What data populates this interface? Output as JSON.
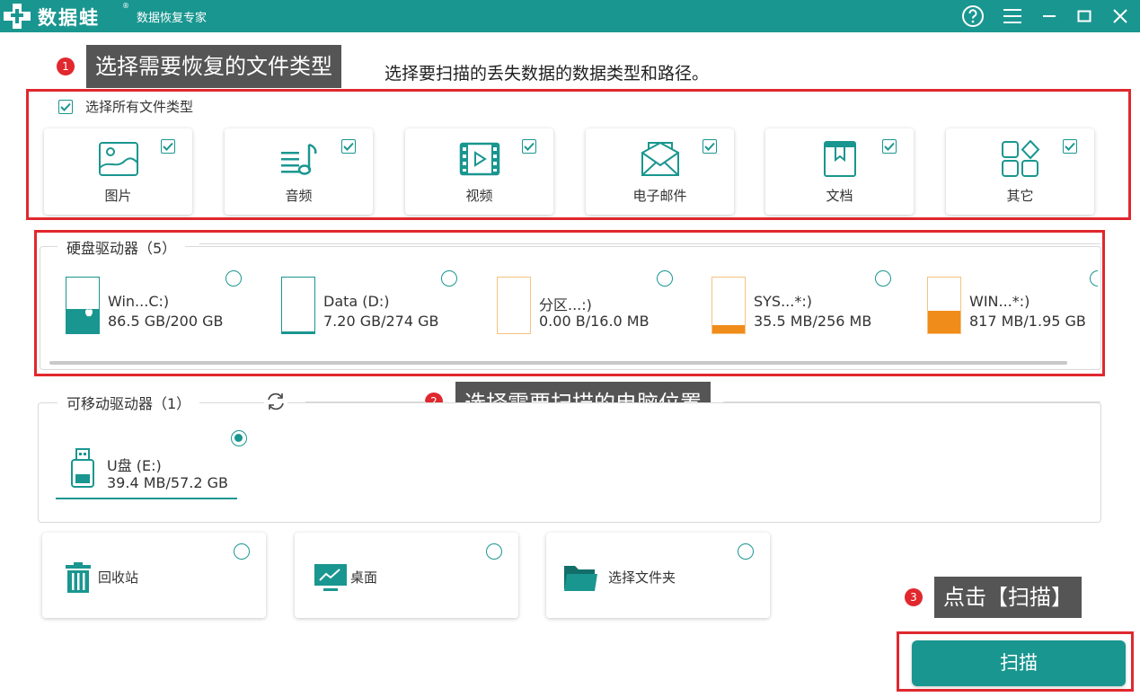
{
  "app": {
    "name": "数据蛙",
    "registered_mark": "®",
    "subtitle": "数据恢复专家"
  },
  "colors": {
    "brand": "#1a9690",
    "accent_red": "#e0282e",
    "orange": "#f08c1a",
    "callout_bg": "#555555"
  },
  "titlebar_icons": [
    "help-icon",
    "menu-icon",
    "minimize-icon",
    "maximize-icon",
    "close-icon"
  ],
  "callouts": [
    {
      "num": "1",
      "text": "选择需要恢复的文件类型"
    },
    {
      "num": "2",
      "text": "选择需要扫描的电脑位置"
    },
    {
      "num": "3",
      "text": "点击【扫描】"
    }
  ],
  "instruction": "选择要扫描的丢失数据的数据类型和路径。",
  "file_types": {
    "select_all_label": "选择所有文件类型",
    "select_all_checked": true,
    "items": [
      {
        "label": "图片",
        "icon": "image-icon",
        "checked": true
      },
      {
        "label": "音频",
        "icon": "music-icon",
        "checked": true
      },
      {
        "label": "视频",
        "icon": "video-icon",
        "checked": true
      },
      {
        "label": "电子邮件",
        "icon": "email-icon",
        "checked": true
      },
      {
        "label": "文档",
        "icon": "document-icon",
        "checked": true
      },
      {
        "label": "其它",
        "icon": "other-icon",
        "checked": true
      }
    ]
  },
  "hard_drives": {
    "title": "硬盘驱动器（5）",
    "items": [
      {
        "name": "Win...C:)",
        "size": "86.5 GB/200 GB",
        "usage": 0.43,
        "color": "#1a9690",
        "outline": "#1a9690",
        "system": true,
        "selected": false
      },
      {
        "name": "Data (D:)",
        "size": "7.20 GB/274 GB",
        "usage": 0.03,
        "color": "#1a9690",
        "outline": "#1a9690",
        "system": false,
        "selected": false
      },
      {
        "name": "分区...:)",
        "size": "0.00  B/16.0 MB",
        "usage": 0,
        "color": "#f08c1a",
        "outline": "#f5c280",
        "system": false,
        "selected": false
      },
      {
        "name": "SYS...*:)",
        "size": "35.5 MB/256 MB",
        "usage": 0.14,
        "color": "#f08c1a",
        "outline": "#f5c280",
        "system": false,
        "selected": false
      },
      {
        "name": "WIN...*:)",
        "size": "817 MB/1.95 GB",
        "usage": 0.41,
        "color": "#f08c1a",
        "outline": "#f5c280",
        "system": false,
        "selected": false
      }
    ]
  },
  "removable_drives": {
    "title": "可移动驱动器（1）",
    "items": [
      {
        "name": "U盘 (E:)",
        "size": "39.4 MB/57.2 GB",
        "selected": true
      }
    ]
  },
  "locations": [
    {
      "label": "回收站",
      "icon": "recycle-bin-icon",
      "selected": false
    },
    {
      "label": "桌面",
      "icon": "desktop-icon",
      "selected": false
    },
    {
      "label": "选择文件夹",
      "icon": "folder-icon",
      "selected": false
    }
  ],
  "scan_button": "扫描"
}
